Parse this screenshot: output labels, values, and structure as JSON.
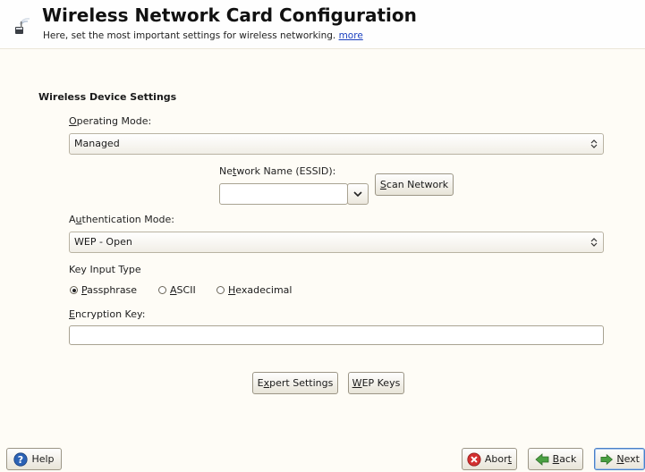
{
  "header": {
    "title": "Wireless Network Card Configuration",
    "subtitle": "Here, set the most important settings for wireless networking.",
    "more_link": "more"
  },
  "section_title": "Wireless Device Settings",
  "operating_mode": {
    "label_mnemonic": "O",
    "label_rest": "perating Mode:",
    "value": "Managed"
  },
  "essid": {
    "label_pre": "Ne",
    "label_mnemonic": "t",
    "label_post": "work Name (ESSID):",
    "value": ""
  },
  "scan_button": {
    "mnemonic": "S",
    "rest": "can Network"
  },
  "auth_mode": {
    "label_pre": "A",
    "label_mnemonic": "u",
    "label_post": "thentication Mode:",
    "value": "WEP - Open"
  },
  "key_input": {
    "label": "Key Input Type",
    "options": [
      {
        "mnemonic": "P",
        "rest": "assphrase",
        "selected": true
      },
      {
        "mnemonic": "A",
        "rest": "SCII",
        "selected": false
      },
      {
        "mnemonic": "H",
        "rest": "exadecimal",
        "selected": false
      }
    ]
  },
  "encryption_key": {
    "label_mnemonic": "E",
    "label_rest": "ncryption Key:",
    "value": ""
  },
  "expert_button": {
    "pre": "E",
    "mnemonic": "x",
    "post": "pert Settings"
  },
  "wep_button": {
    "mnemonic": "W",
    "rest": "EP Keys"
  },
  "footer": {
    "help": "Help",
    "abort_pre": "Abor",
    "abort_mnemonic": "t",
    "back_mnemonic": "B",
    "back_rest": "ack",
    "next_mnemonic": "N",
    "next_rest": "ext"
  },
  "icons": {
    "header": "wireless-card-icon",
    "help": "help-icon",
    "abort": "abort-icon",
    "back": "back-arrow-icon",
    "next": "next-arrow-icon"
  },
  "colors": {
    "link": "#1a3fbf",
    "abort": "#d32f2f",
    "arrow": "#4aa042",
    "focus": "#4a80c8"
  }
}
